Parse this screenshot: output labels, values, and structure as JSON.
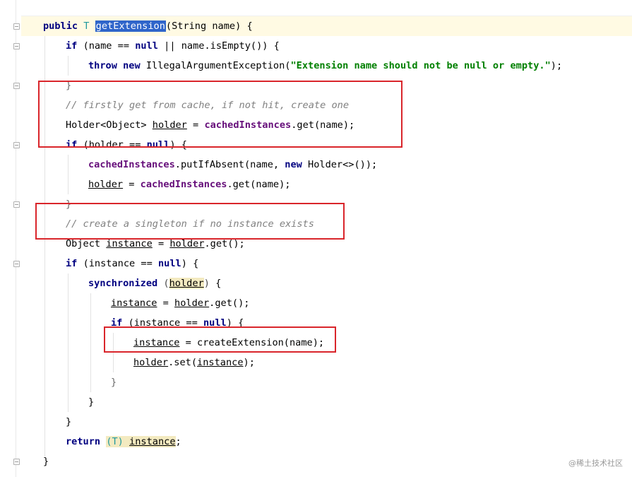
{
  "method_name": "getExtension",
  "tokens": {
    "public": "public",
    "if": "if",
    "throw": "throw",
    "new": "new",
    "null": "null",
    "synchronized": "synchronized",
    "return": "return",
    "T": "T"
  },
  "lines": {
    "l1_params": "(String name) {",
    "l2_cond": "(name == ",
    "l2_rest": " || name.isEmpty()) {",
    "l3_exc": "IllegalArgumentException(",
    "l3_str": "\"Extension name should not be null or empty.\"",
    "l3_end": ");",
    "comment_cache": "// firstly get from cache, if not hit, create one",
    "holder_decl": "Holder<Object> ",
    "holder_var": "holder",
    "eq": " = ",
    "cached": "cachedInstances",
    "get_name": ".get(name);",
    "if_holder": "(holder == ",
    "paren_brace": ") {",
    "put_if_absent": ".putIfAbsent(name, ",
    "holder_diamond": "Holder<>());",
    "comment_singleton": "// create a singleton if no instance exists",
    "object_decl": "Object ",
    "instance": "instance",
    "holder_get": ".get();",
    "if_instance": "(instance == ",
    "create_ext": "createExtension(name);",
    "holder_set": ".set(",
    "close_paren": ");",
    "cast_open": "(",
    "cast_close": ") ",
    "semi": ";",
    "brace_close": "}",
    "brace_open": " {"
  },
  "watermark": "@稀土技术社区"
}
